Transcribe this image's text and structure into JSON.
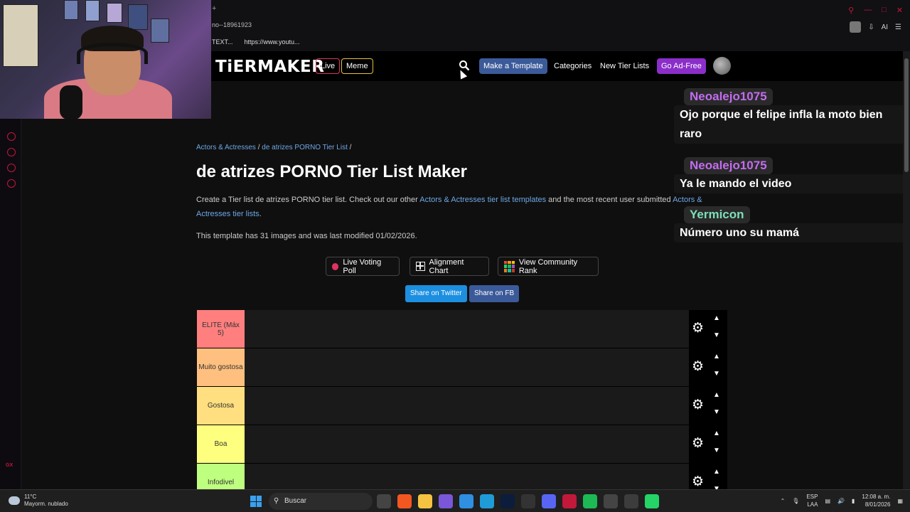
{
  "browser": {
    "tab_text": "+",
    "address_fragment": "no--18961923",
    "bookmarks": [
      "TEXT...",
      "https://www.youtu..."
    ],
    "toolbar_ai": "AI"
  },
  "site": {
    "logo": "TiERMAKER",
    "live_label": "Live",
    "meme_label": "Meme",
    "make_template": "Make a Template",
    "categories": "Categories",
    "new_tier_lists": "New Tier Lists",
    "go_ad_free": "Go Ad-Free"
  },
  "page": {
    "breadcrumb": [
      "Actors & Actresses",
      "de atrizes PORNO Tier List"
    ],
    "breadcrumb_sep": "/",
    "title": "de atrizes PORNO Tier List Maker",
    "desc_prefix": "Create a Tier list de atrizes PORNO tier list. Check out our other ",
    "desc_link1": "Actors & Actresses tier list templates",
    "desc_middle": " and the most recent user submitted ",
    "desc_link2": "Actors & Actresses tier lists",
    "desc_suffix": ".",
    "meta": "This template has 31 images and was last modified 01/02/2026.",
    "live_voting": "Live Voting Poll",
    "alignment_chart": "Alignment Chart",
    "community_rank": "View Community Rank",
    "share_twitter": "Share on Twitter",
    "share_fb": "Share on FB"
  },
  "tiers": [
    {
      "label": "ELITE (Máx 5)",
      "color": "#ff7f7f"
    },
    {
      "label": "Muito gostosa",
      "color": "#ffbf7f"
    },
    {
      "label": "Gostosa",
      "color": "#ffdf7f"
    },
    {
      "label": "Boa",
      "color": "#ffff7f"
    },
    {
      "label": "Infodivel",
      "color": "#bfff7f"
    }
  ],
  "chat": [
    {
      "user": "Neoalejo1075",
      "user_color": "#c36cf0",
      "text": "Ojo porque el felipe infla la moto bien raro"
    },
    {
      "user": "Neoalejo1075",
      "user_color": "#c36cf0",
      "text": "Ya le mando el video"
    },
    {
      "user": "Yermicon",
      "user_color": "#7de0b8",
      "text": "Número uno su mamá"
    }
  ],
  "taskbar": {
    "temp": "11°C",
    "weather": "Mayorm. nublado",
    "search": "Buscar",
    "lang1": "ESP",
    "lang2": "LAA",
    "time": "12:08 a. m.",
    "date": "8/01/2026"
  }
}
